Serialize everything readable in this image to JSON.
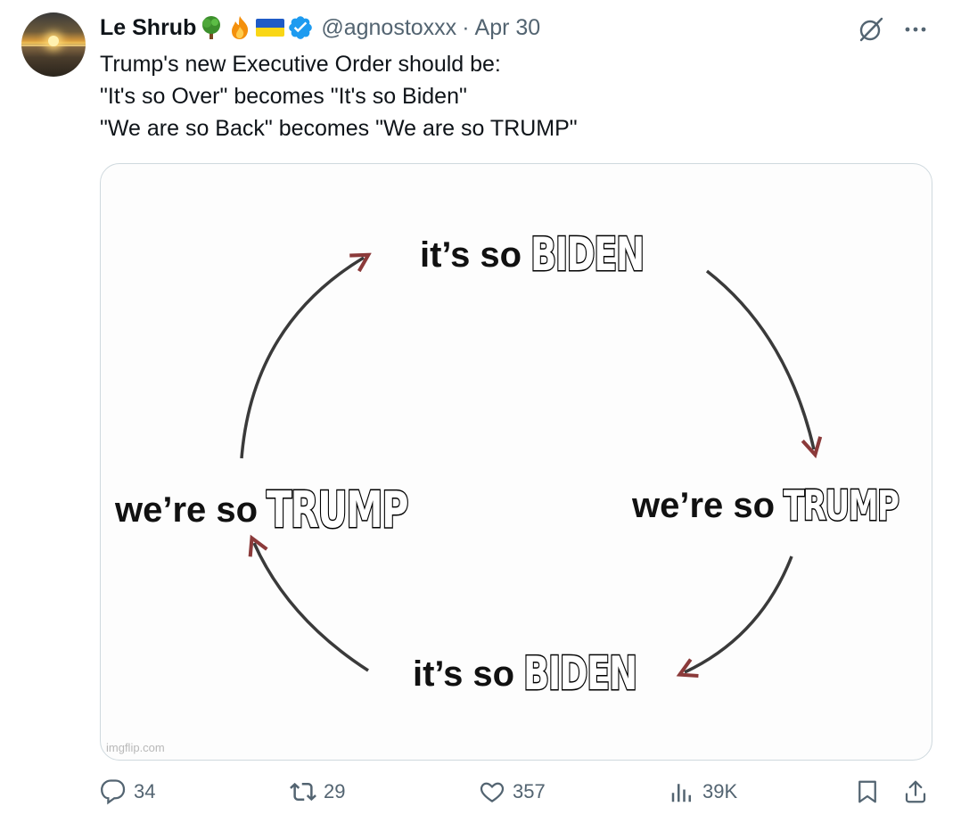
{
  "tweet": {
    "display_name": "Le Shrub",
    "name_emojis": [
      "tree-emoji",
      "fire-emoji",
      "ukraine-flag-emoji"
    ],
    "verified_color": "#1d9bf0",
    "handle": "@agnostoxxx",
    "separator": "·",
    "date": "Apr 30",
    "text_lines": [
      "Trump's new Executive Order should be:",
      "\"It's so Over\" becomes \"It's so Biden\"",
      "\"We are so Back\" becomes \"We are so TRUMP\""
    ]
  },
  "meme": {
    "top": {
      "plain": "it’s so",
      "impact": "BIDEN"
    },
    "right": {
      "plain": "we’re so",
      "impact": "TRUMP"
    },
    "bottom": {
      "plain": "it’s so",
      "impact": "BIDEN"
    },
    "left": {
      "plain": "we’re so",
      "impact": "TRUMP"
    },
    "watermark": "imgflip.com"
  },
  "actions": {
    "replies": "34",
    "reposts": "29",
    "likes": "357",
    "views": "39K"
  },
  "colors": {
    "text_primary": "#0f1419",
    "text_secondary": "#536471",
    "border": "#cfd9de",
    "arrow": "#3a3a3a",
    "arrow_tip": "#8b3a3a"
  }
}
